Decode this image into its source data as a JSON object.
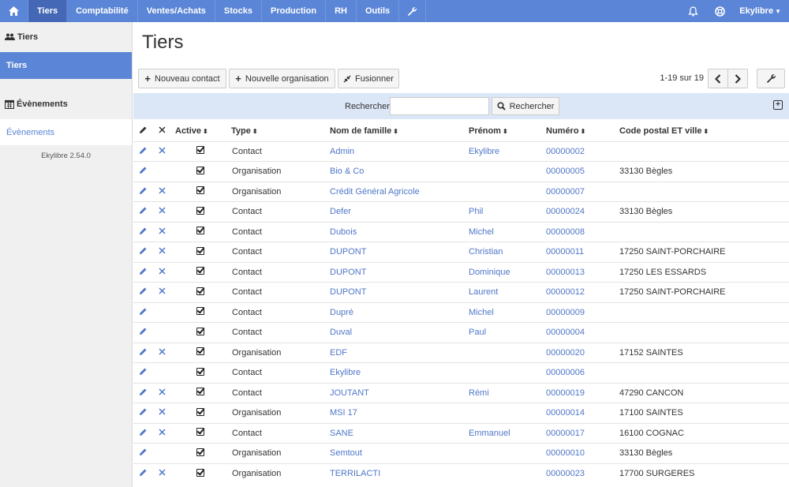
{
  "nav": {
    "items": [
      {
        "label": "Tiers",
        "active": true
      },
      {
        "label": "Comptabilité"
      },
      {
        "label": "Ventes/Achats"
      },
      {
        "label": "Stocks"
      },
      {
        "label": "Production"
      },
      {
        "label": "RH"
      },
      {
        "label": "Outils"
      }
    ],
    "user": "Ekylibre"
  },
  "sidebar": {
    "section1": "Tiers",
    "link1": "Tiers",
    "section2": "Évènements",
    "link2": "Évènements",
    "version": "Ekylibre 2.54.0"
  },
  "page": {
    "title": "Tiers",
    "btn_new_contact": "Nouveau contact",
    "btn_new_org": "Nouvelle organisation",
    "btn_merge": "Fusionner",
    "pagination": "1-19 sur 19",
    "search_label": "Rechercher",
    "search_value": "",
    "search_button": "Rechercher"
  },
  "table": {
    "headers": {
      "active": "Active",
      "type": "Type",
      "nom": "Nom de famille",
      "prenom": "Prénom",
      "numero": "Numéro",
      "cp": "Code postal ET ville"
    },
    "rows": [
      {
        "del": true,
        "type": "Contact",
        "nom": "Admin",
        "prenom": "Ekylibre",
        "numero": "00000002",
        "cp": ""
      },
      {
        "del": false,
        "type": "Organisation",
        "nom": "Bio & Co",
        "prenom": "",
        "numero": "00000005",
        "cp": "33130 Bègles"
      },
      {
        "del": true,
        "type": "Organisation",
        "nom": "Crédit Général Agricole",
        "prenom": "",
        "numero": "00000007",
        "cp": ""
      },
      {
        "del": true,
        "type": "Contact",
        "nom": "Defer",
        "prenom": "Phil",
        "numero": "00000024",
        "cp": "33130 Bègles"
      },
      {
        "del": true,
        "type": "Contact",
        "nom": "Dubois",
        "prenom": "Michel",
        "numero": "00000008",
        "cp": ""
      },
      {
        "del": true,
        "type": "Contact",
        "nom": "DUPONT",
        "prenom": "Christian",
        "numero": "00000011",
        "cp": "17250 SAINT-PORCHAIRE"
      },
      {
        "del": true,
        "type": "Contact",
        "nom": "DUPONT",
        "prenom": "Dominique",
        "numero": "00000013",
        "cp": "17250 LES ESSARDS"
      },
      {
        "del": true,
        "type": "Contact",
        "nom": "DUPONT",
        "prenom": "Laurent",
        "numero": "00000012",
        "cp": "17250 SAINT-PORCHAIRE"
      },
      {
        "del": false,
        "type": "Contact",
        "nom": "Dupré",
        "prenom": "Michel",
        "numero": "00000009",
        "cp": ""
      },
      {
        "del": false,
        "type": "Contact",
        "nom": "Duval",
        "prenom": "Paul",
        "numero": "00000004",
        "cp": ""
      },
      {
        "del": true,
        "type": "Organisation",
        "nom": "EDF",
        "prenom": "",
        "numero": "00000020",
        "cp": "17152 SAINTES"
      },
      {
        "del": false,
        "type": "Contact",
        "nom": "Ekylibre",
        "prenom": "",
        "numero": "00000006",
        "cp": ""
      },
      {
        "del": true,
        "type": "Contact",
        "nom": "JOUTANT",
        "prenom": "Rémi",
        "numero": "00000019",
        "cp": "47290 CANCON"
      },
      {
        "del": true,
        "type": "Organisation",
        "nom": "MSI 17",
        "prenom": "",
        "numero": "00000014",
        "cp": "17100 SAINTES"
      },
      {
        "del": true,
        "type": "Contact",
        "nom": "SANE",
        "prenom": "Emmanuel",
        "numero": "00000017",
        "cp": "16100 COGNAC"
      },
      {
        "del": false,
        "type": "Organisation",
        "nom": "Semtout",
        "prenom": "",
        "numero": "00000010",
        "cp": "33130 Bègles"
      },
      {
        "del": true,
        "type": "Organisation",
        "nom": "TERRILACTI",
        "prenom": "",
        "numero": "00000023",
        "cp": "17700 SURGERES"
      }
    ]
  }
}
